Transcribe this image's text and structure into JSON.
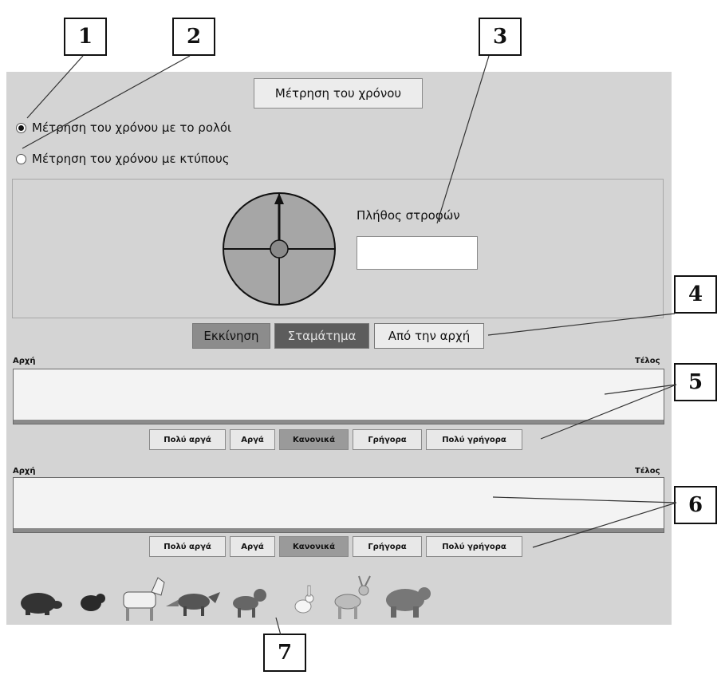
{
  "callouts": [
    "1",
    "2",
    "3",
    "4",
    "5",
    "6",
    "7"
  ],
  "app": {
    "title": "Μέτρηση του χρόνου"
  },
  "mode": {
    "options": [
      "Μέτρηση του χρόνου με το ρολόι",
      "Μέτρηση του χρόνου με κτύπους"
    ],
    "selected": 0
  },
  "clock": {
    "turns_label": "Πλήθος στροφών",
    "turns_value": ""
  },
  "controls": {
    "start": "Εκκίνηση",
    "stop": "Σταμάτημα",
    "reset": "Από την αρχή"
  },
  "tracks": [
    {
      "start_label": "Αρχή",
      "end_label": "Τέλος",
      "speeds": [
        "Πολύ αργά",
        "Αργά",
        "Κανονικά",
        "Γρήγορα",
        "Πολύ γρήγορα"
      ],
      "selected_speed": 2
    },
    {
      "start_label": "Αρχή",
      "end_label": "Τέλος",
      "speeds": [
        "Πολύ αργά",
        "Αργά",
        "Κανονικά",
        "Γρήγορα",
        "Πολύ γρήγορα"
      ],
      "selected_speed": 2
    }
  ],
  "animals": [
    "tortoise-icon",
    "mole-icon",
    "goat-icon",
    "fox-icon",
    "dog-icon",
    "rabbit-icon",
    "deer-icon",
    "bear-icon"
  ],
  "colors": {
    "panel": "#d4d4d4",
    "start_button": "#8c8c8c",
    "stop_button": "#5c5c5c",
    "selected_speed": "#9a9a9a"
  }
}
